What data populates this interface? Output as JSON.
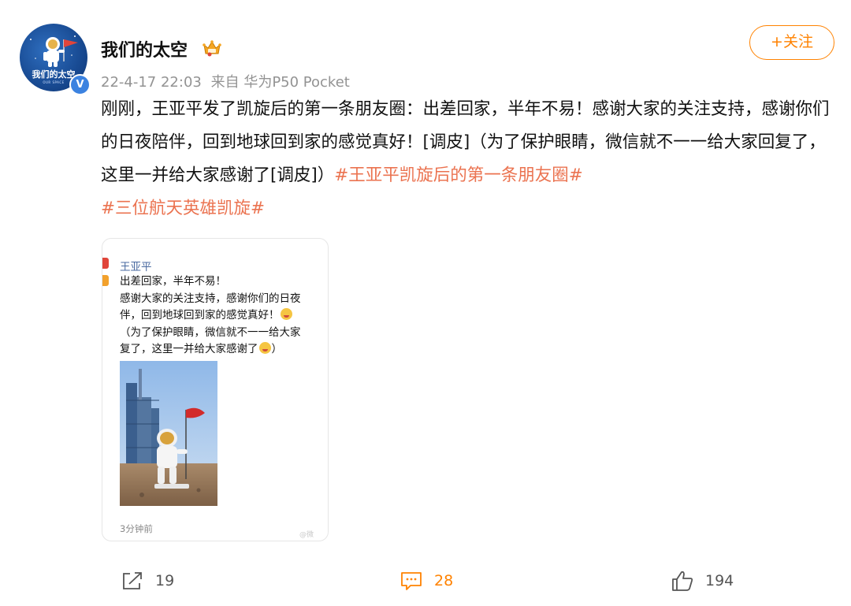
{
  "author": {
    "name": "我们的太空",
    "avatar_text": "我们的太空",
    "avatar_subtext": "OUR SPACE",
    "verified_icon": "V",
    "crown_icon": "crown-icon"
  },
  "meta": {
    "timestamp": "22-4-17 22:03",
    "source": "来自 华为P50 Pocket"
  },
  "follow_button": {
    "label": "+关注"
  },
  "post": {
    "text": "刚刚，王亚平发了凯旋后的第一条朋友圈：出差回家，半年不易！感谢大家的关注支持，感谢你们的日夜陪伴，回到地球回到家的感觉真好！[调皮]（为了保护眼睛，微信就不一一给大家回复了，这里一并给大家感谢了[调皮]）",
    "hashtag1": "#王亚平凯旋后的第一条朋友圈#",
    "hashtag2": "#三位航天英雄凯旋#"
  },
  "embed": {
    "name": "王亚平",
    "line1": "出差回家，半年不易！",
    "line2": "感谢大家的关注支持，感谢你们的日夜",
    "line3": "伴，回到地球回到家的感觉真好！",
    "line4": "（为了保护眼睛，微信就不一一给大家",
    "line5": "复了，这里一并给大家感谢了",
    "line5_end": "）",
    "time": "3分钟前",
    "watermark": "@微"
  },
  "actions": {
    "share_count": "19",
    "comment_count": "28",
    "like_count": "194"
  },
  "colors": {
    "accent": "#ff8200",
    "hashtag": "#eb7350",
    "meta_gray": "#939393"
  }
}
